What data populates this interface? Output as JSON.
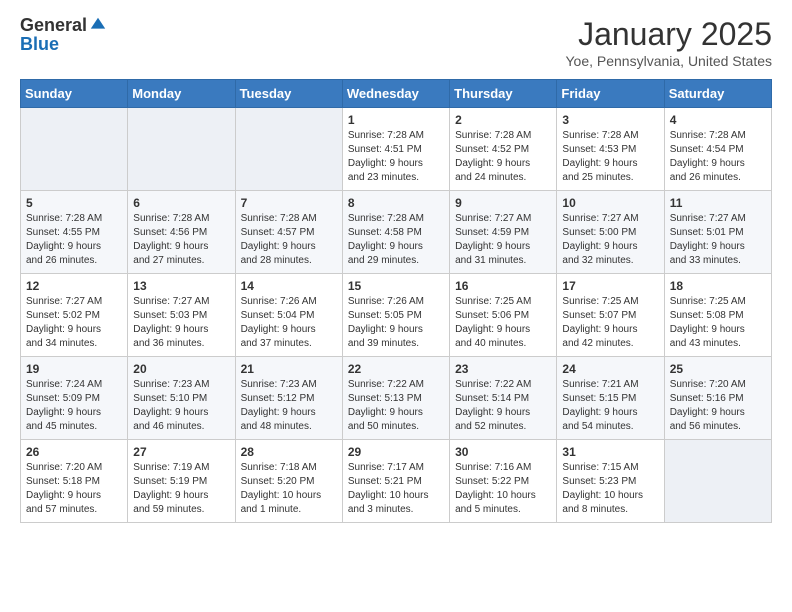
{
  "header": {
    "logo_general": "General",
    "logo_blue": "Blue",
    "month_title": "January 2025",
    "subtitle": "Yoe, Pennsylvania, United States"
  },
  "weekdays": [
    "Sunday",
    "Monday",
    "Tuesday",
    "Wednesday",
    "Thursday",
    "Friday",
    "Saturday"
  ],
  "weeks": [
    [
      {
        "day": "",
        "info": ""
      },
      {
        "day": "",
        "info": ""
      },
      {
        "day": "",
        "info": ""
      },
      {
        "day": "1",
        "info": "Sunrise: 7:28 AM\nSunset: 4:51 PM\nDaylight: 9 hours\nand 23 minutes."
      },
      {
        "day": "2",
        "info": "Sunrise: 7:28 AM\nSunset: 4:52 PM\nDaylight: 9 hours\nand 24 minutes."
      },
      {
        "day": "3",
        "info": "Sunrise: 7:28 AM\nSunset: 4:53 PM\nDaylight: 9 hours\nand 25 minutes."
      },
      {
        "day": "4",
        "info": "Sunrise: 7:28 AM\nSunset: 4:54 PM\nDaylight: 9 hours\nand 26 minutes."
      }
    ],
    [
      {
        "day": "5",
        "info": "Sunrise: 7:28 AM\nSunset: 4:55 PM\nDaylight: 9 hours\nand 26 minutes."
      },
      {
        "day": "6",
        "info": "Sunrise: 7:28 AM\nSunset: 4:56 PM\nDaylight: 9 hours\nand 27 minutes."
      },
      {
        "day": "7",
        "info": "Sunrise: 7:28 AM\nSunset: 4:57 PM\nDaylight: 9 hours\nand 28 minutes."
      },
      {
        "day": "8",
        "info": "Sunrise: 7:28 AM\nSunset: 4:58 PM\nDaylight: 9 hours\nand 29 minutes."
      },
      {
        "day": "9",
        "info": "Sunrise: 7:27 AM\nSunset: 4:59 PM\nDaylight: 9 hours\nand 31 minutes."
      },
      {
        "day": "10",
        "info": "Sunrise: 7:27 AM\nSunset: 5:00 PM\nDaylight: 9 hours\nand 32 minutes."
      },
      {
        "day": "11",
        "info": "Sunrise: 7:27 AM\nSunset: 5:01 PM\nDaylight: 9 hours\nand 33 minutes."
      }
    ],
    [
      {
        "day": "12",
        "info": "Sunrise: 7:27 AM\nSunset: 5:02 PM\nDaylight: 9 hours\nand 34 minutes."
      },
      {
        "day": "13",
        "info": "Sunrise: 7:27 AM\nSunset: 5:03 PM\nDaylight: 9 hours\nand 36 minutes."
      },
      {
        "day": "14",
        "info": "Sunrise: 7:26 AM\nSunset: 5:04 PM\nDaylight: 9 hours\nand 37 minutes."
      },
      {
        "day": "15",
        "info": "Sunrise: 7:26 AM\nSunset: 5:05 PM\nDaylight: 9 hours\nand 39 minutes."
      },
      {
        "day": "16",
        "info": "Sunrise: 7:25 AM\nSunset: 5:06 PM\nDaylight: 9 hours\nand 40 minutes."
      },
      {
        "day": "17",
        "info": "Sunrise: 7:25 AM\nSunset: 5:07 PM\nDaylight: 9 hours\nand 42 minutes."
      },
      {
        "day": "18",
        "info": "Sunrise: 7:25 AM\nSunset: 5:08 PM\nDaylight: 9 hours\nand 43 minutes."
      }
    ],
    [
      {
        "day": "19",
        "info": "Sunrise: 7:24 AM\nSunset: 5:09 PM\nDaylight: 9 hours\nand 45 minutes."
      },
      {
        "day": "20",
        "info": "Sunrise: 7:23 AM\nSunset: 5:10 PM\nDaylight: 9 hours\nand 46 minutes."
      },
      {
        "day": "21",
        "info": "Sunrise: 7:23 AM\nSunset: 5:12 PM\nDaylight: 9 hours\nand 48 minutes."
      },
      {
        "day": "22",
        "info": "Sunrise: 7:22 AM\nSunset: 5:13 PM\nDaylight: 9 hours\nand 50 minutes."
      },
      {
        "day": "23",
        "info": "Sunrise: 7:22 AM\nSunset: 5:14 PM\nDaylight: 9 hours\nand 52 minutes."
      },
      {
        "day": "24",
        "info": "Sunrise: 7:21 AM\nSunset: 5:15 PM\nDaylight: 9 hours\nand 54 minutes."
      },
      {
        "day": "25",
        "info": "Sunrise: 7:20 AM\nSunset: 5:16 PM\nDaylight: 9 hours\nand 56 minutes."
      }
    ],
    [
      {
        "day": "26",
        "info": "Sunrise: 7:20 AM\nSunset: 5:18 PM\nDaylight: 9 hours\nand 57 minutes."
      },
      {
        "day": "27",
        "info": "Sunrise: 7:19 AM\nSunset: 5:19 PM\nDaylight: 9 hours\nand 59 minutes."
      },
      {
        "day": "28",
        "info": "Sunrise: 7:18 AM\nSunset: 5:20 PM\nDaylight: 10 hours\nand 1 minute."
      },
      {
        "day": "29",
        "info": "Sunrise: 7:17 AM\nSunset: 5:21 PM\nDaylight: 10 hours\nand 3 minutes."
      },
      {
        "day": "30",
        "info": "Sunrise: 7:16 AM\nSunset: 5:22 PM\nDaylight: 10 hours\nand 5 minutes."
      },
      {
        "day": "31",
        "info": "Sunrise: 7:15 AM\nSunset: 5:23 PM\nDaylight: 10 hours\nand 8 minutes."
      },
      {
        "day": "",
        "info": ""
      }
    ]
  ]
}
